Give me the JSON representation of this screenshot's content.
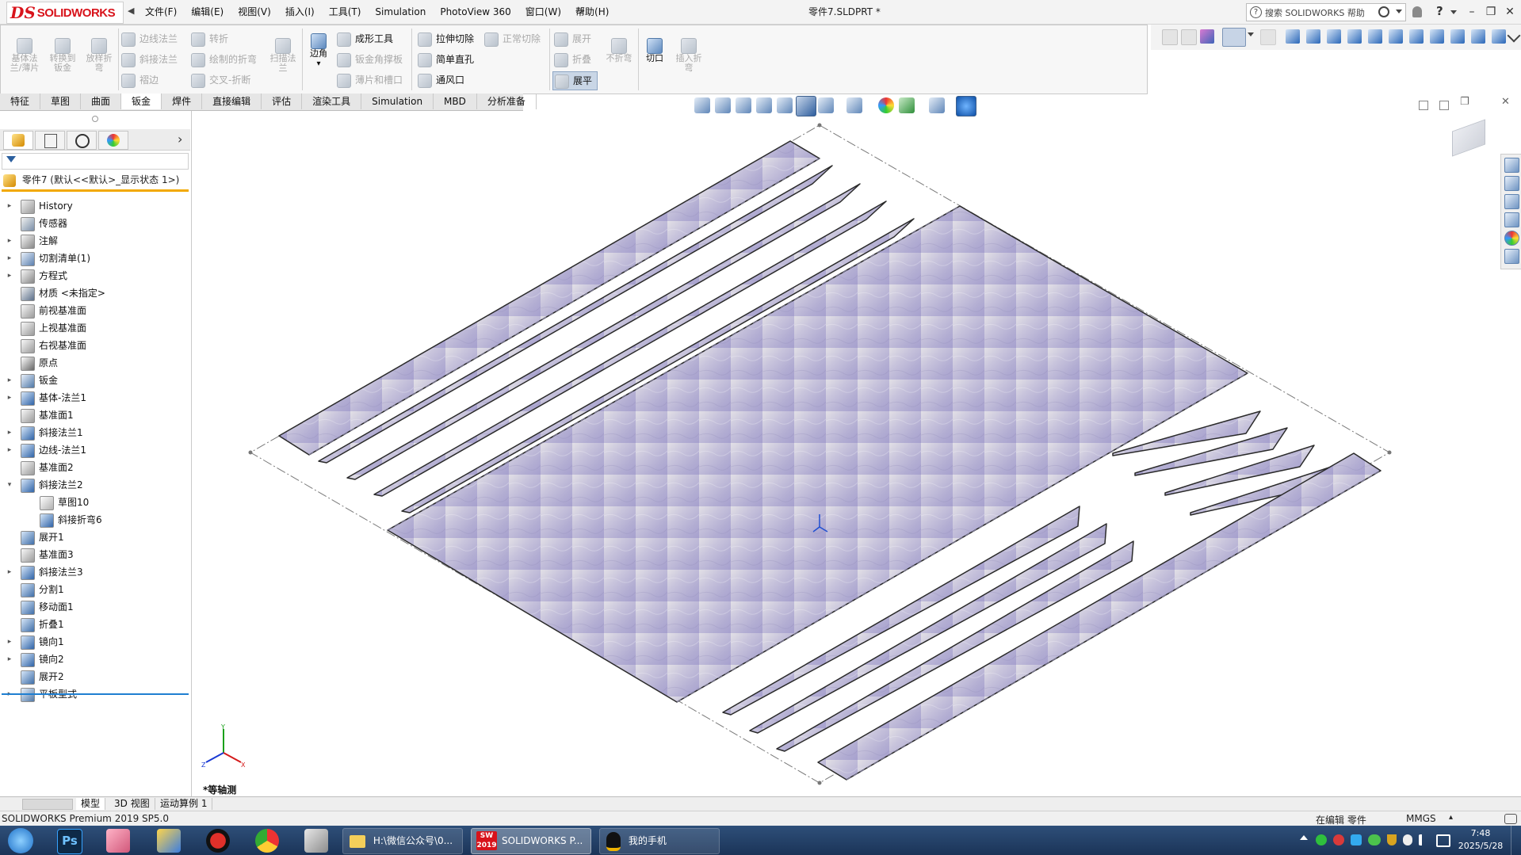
{
  "app": {
    "logo_mark": "DS",
    "logo_text": "SOLIDWORKS",
    "document_title": "零件7.SLDPRT *",
    "search_placeholder": "搜索 SOLIDWORKS 帮助",
    "help_glyph": "?",
    "back_arrow": "◀",
    "pin_glyph": "⇥"
  },
  "menu": [
    "文件(F)",
    "编辑(E)",
    "视图(V)",
    "插入(I)",
    "工具(T)",
    "Simulation",
    "PhotoView 360",
    "窗口(W)",
    "帮助(H)"
  ],
  "window_controls": {
    "minimize": "–",
    "restore": "❐",
    "close": "✕"
  },
  "command_manager": {
    "large_tools": [
      {
        "label": "基体法\n兰/薄片",
        "enabled": false
      },
      {
        "label": "转换到\n钣金",
        "enabled": false
      },
      {
        "label": "放样折\n弯",
        "enabled": false
      }
    ],
    "col1": [
      {
        "label": "边线法兰",
        "enabled": false
      },
      {
        "label": "斜接法兰",
        "enabled": false
      },
      {
        "label": "褶边",
        "enabled": false
      }
    ],
    "col2": [
      {
        "label": "转折",
        "enabled": false
      },
      {
        "label": "绘制的折弯",
        "enabled": false
      },
      {
        "label": "交叉-折断",
        "enabled": false
      }
    ],
    "sweep": {
      "label": "扫描法\n兰",
      "enabled": false
    },
    "corner": {
      "label": "边角",
      "enabled": true
    },
    "corner_dropdown": "▾",
    "col3": [
      {
        "label": "成形工具",
        "enabled": true
      },
      {
        "label": "钣金角撑板",
        "enabled": false
      },
      {
        "label": "薄片和槽口",
        "enabled": false
      }
    ],
    "col4": [
      {
        "label": "拉伸切除",
        "enabled": true
      },
      {
        "label": "简单直孔",
        "enabled": true
      },
      {
        "label": "通风口",
        "enabled": true
      }
    ],
    "normal_cut": {
      "label": "正常切除",
      "enabled": false
    },
    "col5": [
      {
        "label": "展开",
        "enabled": false
      },
      {
        "label": "折叠",
        "enabled": false
      },
      {
        "label": "展平",
        "enabled": true
      }
    ],
    "no_bends": {
      "label": "不折弯",
      "enabled": false
    },
    "rip": {
      "label": "切口",
      "enabled": true
    },
    "insert_bends": {
      "label": "插入折\n弯",
      "enabled": false
    }
  },
  "tabs": [
    "特征",
    "草图",
    "曲面",
    "钣金",
    "焊件",
    "直接编辑",
    "评估",
    "渲染工具",
    "Simulation",
    "MBD",
    "分析准备"
  ],
  "active_tab": "钣金",
  "panel_more": "›",
  "tree_root": "零件7 (默认<<默认>_显示状态 1>)",
  "tree": [
    {
      "label": "History",
      "level": 0,
      "expander": "▸",
      "icon": "history-icon"
    },
    {
      "label": "传感器",
      "level": 0,
      "expander": "",
      "icon": "sensor-icon"
    },
    {
      "label": "注解",
      "level": 0,
      "expander": "▸",
      "icon": "annotation-icon"
    },
    {
      "label": "切割清单(1)",
      "level": 0,
      "expander": "▸",
      "icon": "cut-list-icon"
    },
    {
      "label": "方程式",
      "level": 0,
      "expander": "▸",
      "icon": "equation-icon"
    },
    {
      "label": "材质 <未指定>",
      "level": 0,
      "expander": "",
      "icon": "material-icon"
    },
    {
      "label": "前视基准面",
      "level": 0,
      "expander": "",
      "icon": "plane-icon"
    },
    {
      "label": "上视基准面",
      "level": 0,
      "expander": "",
      "icon": "plane-icon"
    },
    {
      "label": "右视基准面",
      "level": 0,
      "expander": "",
      "icon": "plane-icon"
    },
    {
      "label": "原点",
      "level": 0,
      "expander": "",
      "icon": "origin-icon"
    },
    {
      "label": "钣金",
      "level": 0,
      "expander": "▸",
      "icon": "sheet-metal-icon"
    },
    {
      "label": "基体-法兰1",
      "level": 0,
      "expander": "▸",
      "icon": "base-flange-icon"
    },
    {
      "label": "基准面1",
      "level": 0,
      "expander": "",
      "icon": "plane-icon"
    },
    {
      "label": "斜接法兰1",
      "level": 0,
      "expander": "▸",
      "icon": "miter-flange-icon"
    },
    {
      "label": "边线-法兰1",
      "level": 0,
      "expander": "▸",
      "icon": "edge-flange-icon"
    },
    {
      "label": "基准面2",
      "level": 0,
      "expander": "",
      "icon": "plane-icon"
    },
    {
      "label": "斜接法兰2",
      "level": 0,
      "expander": "▾",
      "icon": "miter-flange-icon"
    },
    {
      "label": "草图10",
      "level": 1,
      "expander": "",
      "icon": "sketch-icon"
    },
    {
      "label": "斜接折弯6",
      "level": 1,
      "expander": "",
      "icon": "bend-icon"
    },
    {
      "label": "展开1",
      "level": 0,
      "expander": "",
      "icon": "unfold-icon"
    },
    {
      "label": "基准面3",
      "level": 0,
      "expander": "",
      "icon": "plane-icon"
    },
    {
      "label": "斜接法兰3",
      "level": 0,
      "expander": "▸",
      "icon": "miter-flange-icon"
    },
    {
      "label": "分割1",
      "level": 0,
      "expander": "",
      "icon": "split-icon"
    },
    {
      "label": "移动面1",
      "level": 0,
      "expander": "",
      "icon": "move-face-icon"
    },
    {
      "label": "折叠1",
      "level": 0,
      "expander": "",
      "icon": "fold-icon"
    },
    {
      "label": "镜向1",
      "level": 0,
      "expander": "▸",
      "icon": "mirror-icon"
    },
    {
      "label": "镜向2",
      "level": 0,
      "expander": "▸",
      "icon": "mirror-icon"
    },
    {
      "label": "展开2",
      "level": 0,
      "expander": "",
      "icon": "unfold-icon"
    },
    {
      "label": "平板型式",
      "level": 0,
      "expander": "▸",
      "icon": "flat-pattern-icon"
    }
  ],
  "view": {
    "orientation_label": "*等轴测",
    "triad": {
      "x": "X",
      "y": "Y",
      "z": "Z"
    }
  },
  "bottom_tabs": [
    "模型",
    "3D 视图",
    "运动算例 1"
  ],
  "status": {
    "left": "SOLIDWORKS Premium 2019 SP5.0",
    "mode": "在编辑 零件",
    "units": "MMGS",
    "units_caret": "▴"
  },
  "taskbar": {
    "tasks": [
      {
        "label": "H:\\微信公众号\\0..."
      },
      {
        "label": "SOLIDWORKS P...",
        "badge": "2019",
        "mark": "SW"
      },
      {
        "label": "我的手机"
      }
    ],
    "ps_mark": "Ps",
    "time": "7:48",
    "date": "2025/5/28"
  },
  "colors": {
    "accent": "#1f7fd1",
    "brand_red": "#d8131b",
    "tree_rule": "#f2a900",
    "sheet_fill": "#b9b4d6"
  }
}
